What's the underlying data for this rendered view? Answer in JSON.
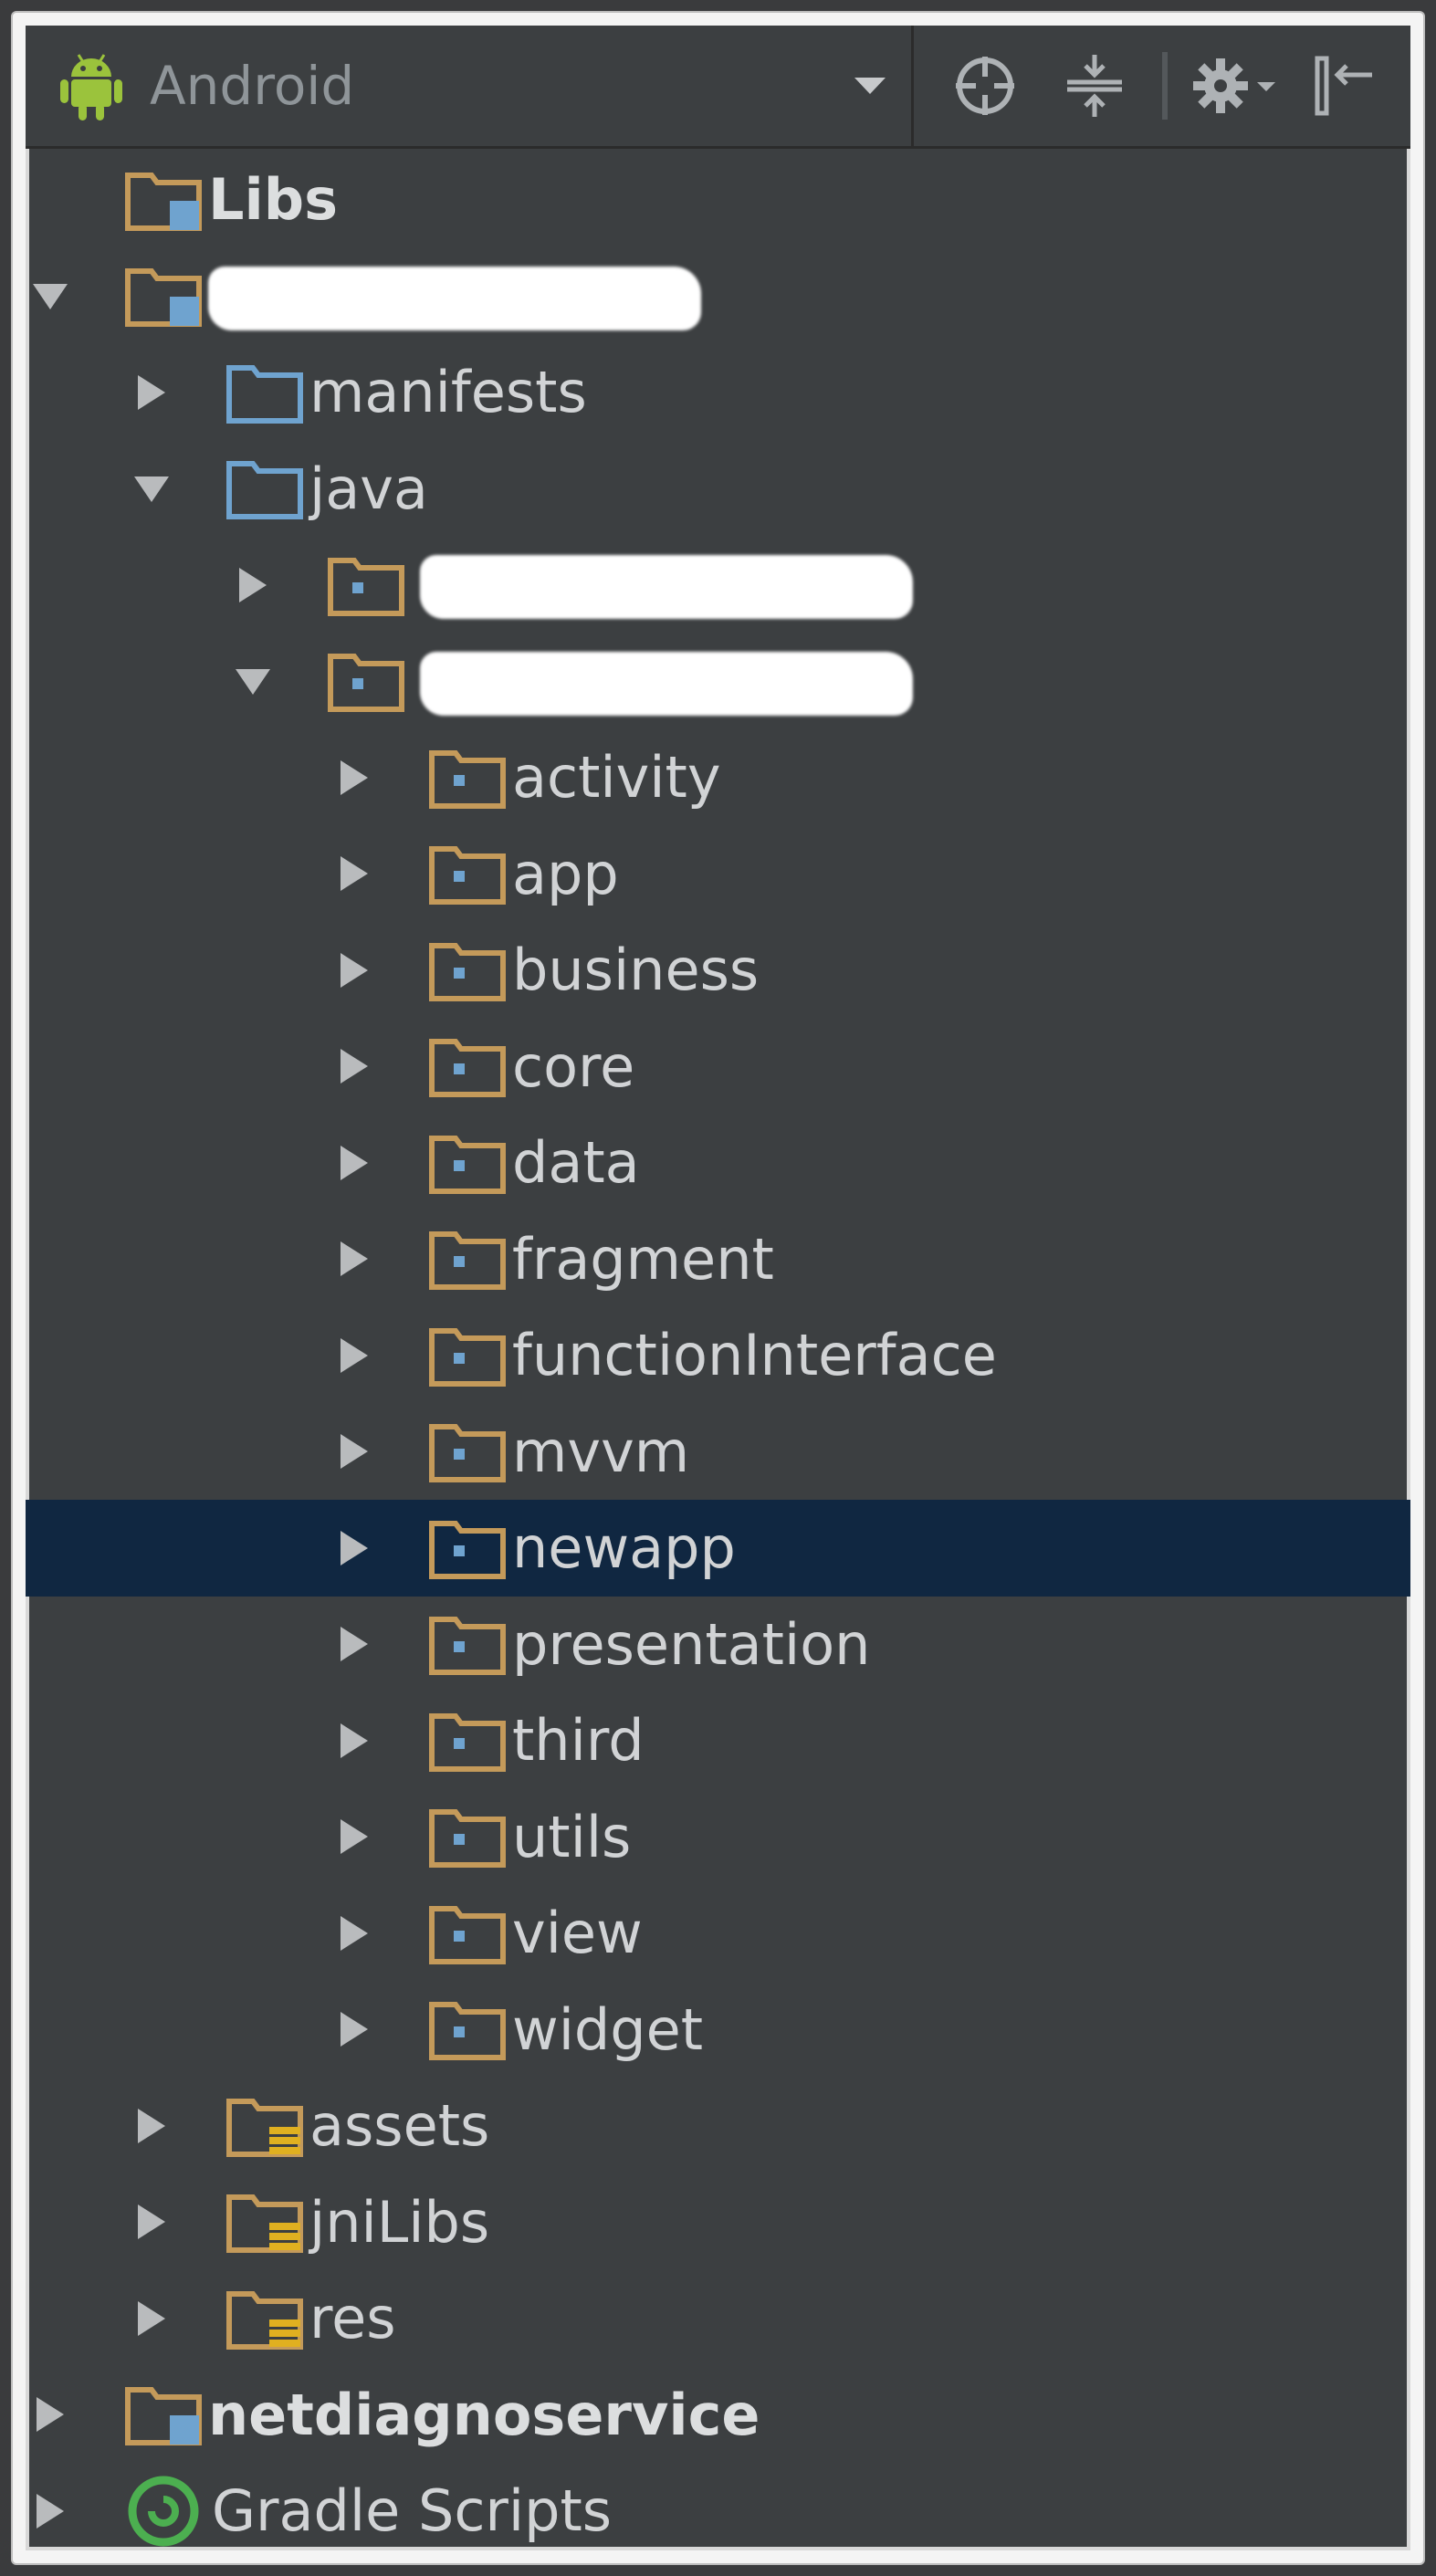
{
  "toolbar": {
    "title": "Android",
    "icons": [
      "android-icon",
      "dropdown-caret-icon",
      "crosshair-icon",
      "collapse-all-icon",
      "gear-icon",
      "hide-panel-icon"
    ]
  },
  "tree": [
    {
      "label": "Libs",
      "kind": "module",
      "bold": true
    },
    {
      "label": "",
      "kind": "module",
      "redacted": true
    },
    {
      "label": "manifests",
      "kind": "source-folder"
    },
    {
      "label": "java",
      "kind": "source-folder"
    },
    {
      "label": "",
      "kind": "package",
      "redacted": true
    },
    {
      "label": "",
      "kind": "package",
      "redacted": true
    },
    {
      "label": "activity",
      "kind": "package"
    },
    {
      "label": "app",
      "kind": "package"
    },
    {
      "label": "business",
      "kind": "package"
    },
    {
      "label": "core",
      "kind": "package"
    },
    {
      "label": "data",
      "kind": "package"
    },
    {
      "label": "fragment",
      "kind": "package"
    },
    {
      "label": "functionInterface",
      "kind": "package"
    },
    {
      "label": "mvvm",
      "kind": "package"
    },
    {
      "label": "newapp",
      "kind": "package",
      "selected": true
    },
    {
      "label": "presentation",
      "kind": "package"
    },
    {
      "label": "third",
      "kind": "package"
    },
    {
      "label": "utils",
      "kind": "package"
    },
    {
      "label": "view",
      "kind": "package"
    },
    {
      "label": "widget",
      "kind": "package"
    },
    {
      "label": "assets",
      "kind": "resource-folder"
    },
    {
      "label": "jniLibs",
      "kind": "resource-folder"
    },
    {
      "label": "res",
      "kind": "resource-folder"
    },
    {
      "label": "netdiagnoservice",
      "kind": "module",
      "bold": true
    },
    {
      "label": "Gradle Scripts",
      "kind": "gradle"
    }
  ],
  "colors": {
    "panel": "#3c3f41",
    "selection": "#102741",
    "text": "#d1d3d5",
    "folder_orange": "#c49a5a",
    "folder_blue": "#6fa3cf",
    "android_green": "#9bc33c",
    "gradle_green": "#4caf50"
  }
}
